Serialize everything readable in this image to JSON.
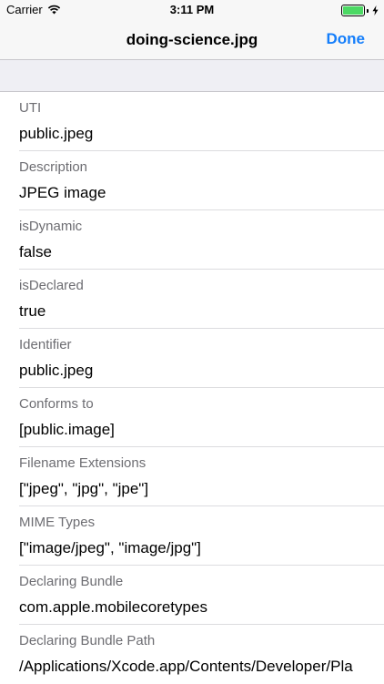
{
  "status_bar": {
    "carrier": "Carrier",
    "time": "3:11 PM",
    "battery_level": 1.0,
    "battery_color": "#4cd964"
  },
  "nav": {
    "title": "doing-science.jpg",
    "done_label": "Done",
    "accent_color": "#147efb"
  },
  "rows": [
    {
      "label": "UTI",
      "value": "public.jpeg"
    },
    {
      "label": "Description",
      "value": "JPEG image"
    },
    {
      "label": "isDynamic",
      "value": "false"
    },
    {
      "label": "isDeclared",
      "value": "true"
    },
    {
      "label": "Identifier",
      "value": "public.jpeg"
    },
    {
      "label": "Conforms to",
      "value": "[public.image]"
    },
    {
      "label": "Filename Extensions",
      "value": "[\"jpeg\", \"jpg\", \"jpe\"]"
    },
    {
      "label": "MIME Types",
      "value": "[\"image/jpeg\", \"image/jpg\"]"
    },
    {
      "label": "Declaring Bundle",
      "value": "com.apple.mobilecoretypes"
    },
    {
      "label": "Declaring Bundle Path",
      "value": "/Applications/Xcode.app/Contents/Developer/Pla"
    }
  ]
}
